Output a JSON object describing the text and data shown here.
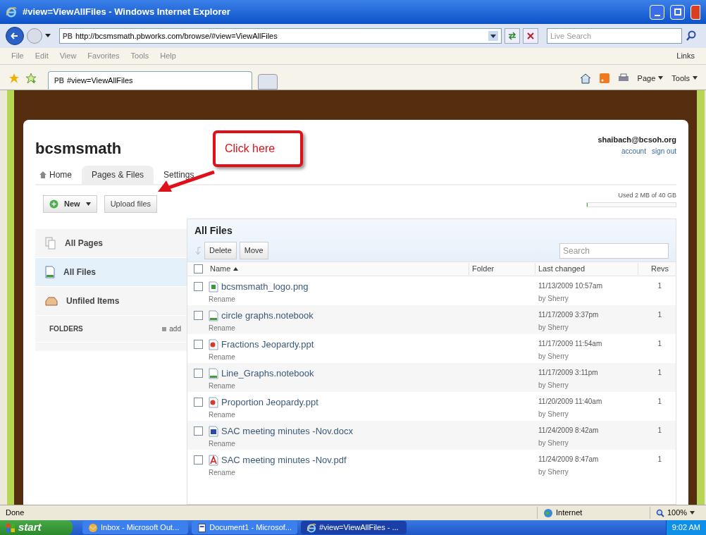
{
  "browser": {
    "title": "#view=ViewAllFiles - Windows Internet Explorer",
    "address_icon": "PB",
    "address": "http://bcsmsmath.pbworks.com/browse/#view=ViewAllFiles",
    "search_placeholder": "Live Search",
    "menu": [
      "File",
      "Edit",
      "View",
      "Favorites",
      "Tools",
      "Help"
    ],
    "links": "Links",
    "tab_icon": "PB",
    "tab": "#view=ViewAllFiles",
    "tools": [
      "Page",
      "Tools"
    ],
    "status": "Done",
    "zone": "Internet",
    "zoom": "100%"
  },
  "site": {
    "name": "bcsmsmath",
    "user": "shaibach@bcsoh.org",
    "user_links": [
      "account",
      "sign out"
    ],
    "tabs": [
      {
        "label": "Home",
        "selected": false
      },
      {
        "label": "Pages & Files",
        "selected": true
      },
      {
        "label": "Settings",
        "selected": false
      }
    ],
    "new_button": "New",
    "upload_button": "Upload files",
    "usage": "Used 2 MB of 40 GB",
    "usage_bar": {
      "level": 0.01
    }
  },
  "sidebar": {
    "items": [
      {
        "label": "All Pages",
        "kind": "pages",
        "selected": false
      },
      {
        "label": "All Files",
        "kind": "files",
        "selected": true
      },
      {
        "label": "Unfiled Items",
        "kind": "unfiled",
        "selected": false
      }
    ],
    "folders": "FOLDERS",
    "add": "add"
  },
  "files": {
    "title": "All Files",
    "actions": [
      "Delete",
      "Move"
    ],
    "search_placeholder": "Search",
    "columns": [
      "Name",
      "Folder",
      "Last changed",
      "Revs"
    ],
    "select_all": {
      "checked": false
    },
    "rows": [
      {
        "name": "bcsmsmath_logo.png",
        "kind": "image",
        "rename": "Rename",
        "changed": "11/13/2009 10:57am",
        "by": "by Sherry",
        "revs": "1",
        "checked": false
      },
      {
        "name": "circle graphs.notebook",
        "kind": "notebook",
        "rename": "Rename",
        "changed": "11/17/2009 3:37pm",
        "by": "by Sherry",
        "revs": "1",
        "checked": false
      },
      {
        "name": "Fractions Jeopardy.ppt",
        "kind": "ppt",
        "rename": "Rename",
        "changed": "11/17/2009 11:54am",
        "by": "by Sherry",
        "revs": "1",
        "checked": false
      },
      {
        "name": "Line_Graphs.notebook",
        "kind": "notebook",
        "rename": "Rename",
        "changed": "11/17/2009 3:11pm",
        "by": "by Sherry",
        "revs": "1",
        "checked": false
      },
      {
        "name": "Proportion Jeopardy.ppt",
        "kind": "ppt",
        "rename": "Rename",
        "changed": "11/20/2009 11:40am",
        "by": "by Sherry",
        "revs": "1",
        "checked": false
      },
      {
        "name": "SAC meeting minutes -Nov.docx",
        "kind": "doc",
        "rename": "Rename",
        "changed": "11/24/2009 8:42am",
        "by": "by Sherry",
        "revs": "1",
        "checked": false
      },
      {
        "name": "SAC meeting minutes -Nov.pdf",
        "kind": "pdf",
        "rename": "Rename",
        "changed": "11/24/2009 8:47am",
        "by": "by Sherry",
        "revs": "1",
        "checked": false
      }
    ]
  },
  "callout": {
    "text": "Click here"
  },
  "taskbar": {
    "start": "start",
    "items": [
      {
        "label": "Inbox - Microsoft Out...",
        "kind": "mail",
        "selected": false
      },
      {
        "label": "Document1 - Microsof...",
        "kind": "doc",
        "selected": false
      },
      {
        "label": "#view=ViewAllFiles - ...",
        "kind": "browser",
        "selected": true
      }
    ],
    "clock": "9:02 AM"
  }
}
